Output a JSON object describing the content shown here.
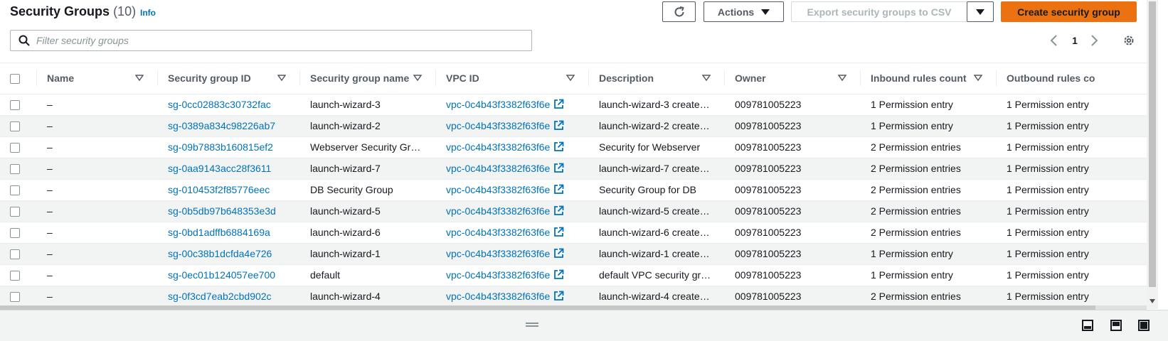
{
  "header": {
    "title": "Security Groups",
    "count": "(10)",
    "info": "Info",
    "actions_label": "Actions",
    "export_label": "Export security groups to CSV",
    "create_label": "Create security group"
  },
  "search": {
    "placeholder": "Filter security groups",
    "value": ""
  },
  "pagination": {
    "current_page": "1"
  },
  "table": {
    "columns": [
      "Name",
      "Security group ID",
      "Security group name",
      "VPC ID",
      "Description",
      "Owner",
      "Inbound rules count",
      "Outbound rules co"
    ],
    "rows": [
      {
        "name": "–",
        "id": "sg-0cc02883c30732fac",
        "group_name": "launch-wizard-3",
        "vpc": "vpc-0c4b43f3382f63f6e",
        "description": "launch-wizard-3 create…",
        "owner": "009781005223",
        "inbound": "1 Permission entry",
        "outbound": "1 Permission entry"
      },
      {
        "name": "–",
        "id": "sg-0389a834c98226ab7",
        "group_name": "launch-wizard-2",
        "vpc": "vpc-0c4b43f3382f63f6e",
        "description": "launch-wizard-2 create…",
        "owner": "009781005223",
        "inbound": "1 Permission entry",
        "outbound": "1 Permission entry"
      },
      {
        "name": "–",
        "id": "sg-09b7883b160815ef2",
        "group_name": "Webserver Security Gr…",
        "vpc": "vpc-0c4b43f3382f63f6e",
        "description": "Security for Webserver",
        "owner": "009781005223",
        "inbound": "2 Permission entries",
        "outbound": "1 Permission entry"
      },
      {
        "name": "–",
        "id": "sg-0aa9143acc28f3611",
        "group_name": "launch-wizard-7",
        "vpc": "vpc-0c4b43f3382f63f6e",
        "description": "launch-wizard-7 create…",
        "owner": "009781005223",
        "inbound": "2 Permission entries",
        "outbound": "1 Permission entry"
      },
      {
        "name": "–",
        "id": "sg-010453f2f85776eec",
        "group_name": "DB Security Group",
        "vpc": "vpc-0c4b43f3382f63f6e",
        "description": "Security Group for DB",
        "owner": "009781005223",
        "inbound": "2 Permission entries",
        "outbound": "1 Permission entry"
      },
      {
        "name": "–",
        "id": "sg-0b5db97b648353e3d",
        "group_name": "launch-wizard-5",
        "vpc": "vpc-0c4b43f3382f63f6e",
        "description": "launch-wizard-5 create…",
        "owner": "009781005223",
        "inbound": "2 Permission entries",
        "outbound": "1 Permission entry"
      },
      {
        "name": "–",
        "id": "sg-0bd1adffb6884169a",
        "group_name": "launch-wizard-6",
        "vpc": "vpc-0c4b43f3382f63f6e",
        "description": "launch-wizard-6 create…",
        "owner": "009781005223",
        "inbound": "2 Permission entries",
        "outbound": "1 Permission entry"
      },
      {
        "name": "–",
        "id": "sg-00c38b1dcfda4e726",
        "group_name": "launch-wizard-1",
        "vpc": "vpc-0c4b43f3382f63f6e",
        "description": "launch-wizard-1 create…",
        "owner": "009781005223",
        "inbound": "1 Permission entry",
        "outbound": "1 Permission entry"
      },
      {
        "name": "–",
        "id": "sg-0ec01b124057ee700",
        "group_name": "default",
        "vpc": "vpc-0c4b43f3382f63f6e",
        "description": "default VPC security gr…",
        "owner": "009781005223",
        "inbound": "1 Permission entry",
        "outbound": "1 Permission entry"
      },
      {
        "name": "–",
        "id": "sg-0f3cd7eab2cbd902c",
        "group_name": "launch-wizard-4",
        "vpc": "vpc-0c4b43f3382f63f6e",
        "description": "launch-wizard-4 create…",
        "owner": "009781005223",
        "inbound": "2 Permission entries",
        "outbound": "1 Permission entry"
      }
    ]
  },
  "icons": {
    "refresh": "refresh-icon",
    "caret": "caret-down-icon",
    "search": "search-icon",
    "prev": "chevron-left-icon",
    "next": "chevron-right-icon",
    "settings": "gear-icon",
    "external": "external-link-icon",
    "sort": "sort-icon",
    "panel_bottom": "panel-bottom-icon",
    "panel_side": "panel-side-icon",
    "panel_full": "panel-full-icon"
  },
  "colors": {
    "primary_button": "#ec7211",
    "link": "#0073bb",
    "stripe": "#f2f3f3"
  }
}
